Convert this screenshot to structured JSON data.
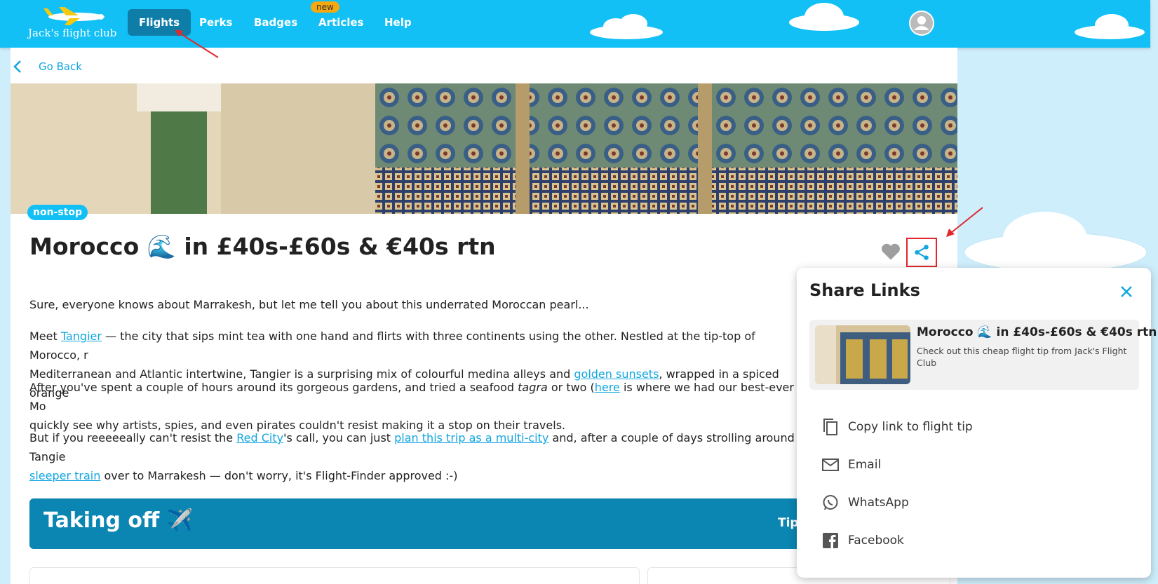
{
  "header": {
    "logo_text": "Jack's flight club",
    "nav": [
      {
        "label": "Flights"
      },
      {
        "label": "Perks"
      },
      {
        "label": "Badges"
      },
      {
        "label": "Articles"
      },
      {
        "label": "Help"
      }
    ],
    "badge_new": "new"
  },
  "page": {
    "go_back": "Go Back",
    "tag": "non-stop",
    "title": "Morocco 🌊 in £40s-£60s & €40s rtn",
    "p1": "Sure, everyone knows about Marrakesh, but let me tell you about this underrated Moroccan pearl...",
    "p2": {
      "a": "Meet ",
      "link1": "Tangier",
      "b": " — the city that sips mint tea with one hand and flirts with three continents using the other. Nestled at the tip-top of Morocco, r",
      "c": "Mediterranean and Atlantic intertwine, Tangier is a surprising mix of colourful medina alleys and ",
      "link2": "golden sunsets",
      "d": ", wrapped in a spiced orange"
    },
    "p3": {
      "a": "After you've spent a couple of hours around its gorgeous gardens, and tried a seafood ",
      "em": "tagra",
      "b": " or two (",
      "link": "here",
      "c": " is where we had our best-ever Mo",
      "d": "quickly see why artists, spies, and even pirates couldn't resist making it a stop on their travels."
    },
    "p4": {
      "a": "But if you reeeeeally can't resist the ",
      "link1": "Red City",
      "b": "'s call, you can just ",
      "link2": "plan this trip as a multi-city",
      "c": " and, after a couple of days strolling around Tangie",
      "link3": "sleeper train",
      "d": " over to Marrakesh — don't worry, it's Flight-Finder approved :-)"
    },
    "banner_title": "Taking off ✈️",
    "banner_tip": "Tip"
  },
  "share": {
    "title": "Share Links",
    "preview_title": "Morocco 🌊 in £40s-£60s & €40s rtn",
    "preview_desc": "Check out this cheap flight tip from Jack's Flight Club",
    "options": [
      {
        "label": "Copy link to flight tip",
        "icon": "copy-icon"
      },
      {
        "label": "Email",
        "icon": "email-icon"
      },
      {
        "label": "WhatsApp",
        "icon": "whatsapp-icon"
      },
      {
        "label": "Facebook",
        "icon": "facebook-icon"
      }
    ]
  },
  "colors": {
    "brand": "#12c0f5",
    "active_nav": "#0e7ea8",
    "link": "#12a6e0",
    "banner": "#0b85b1",
    "highlight": "#e0282e"
  }
}
